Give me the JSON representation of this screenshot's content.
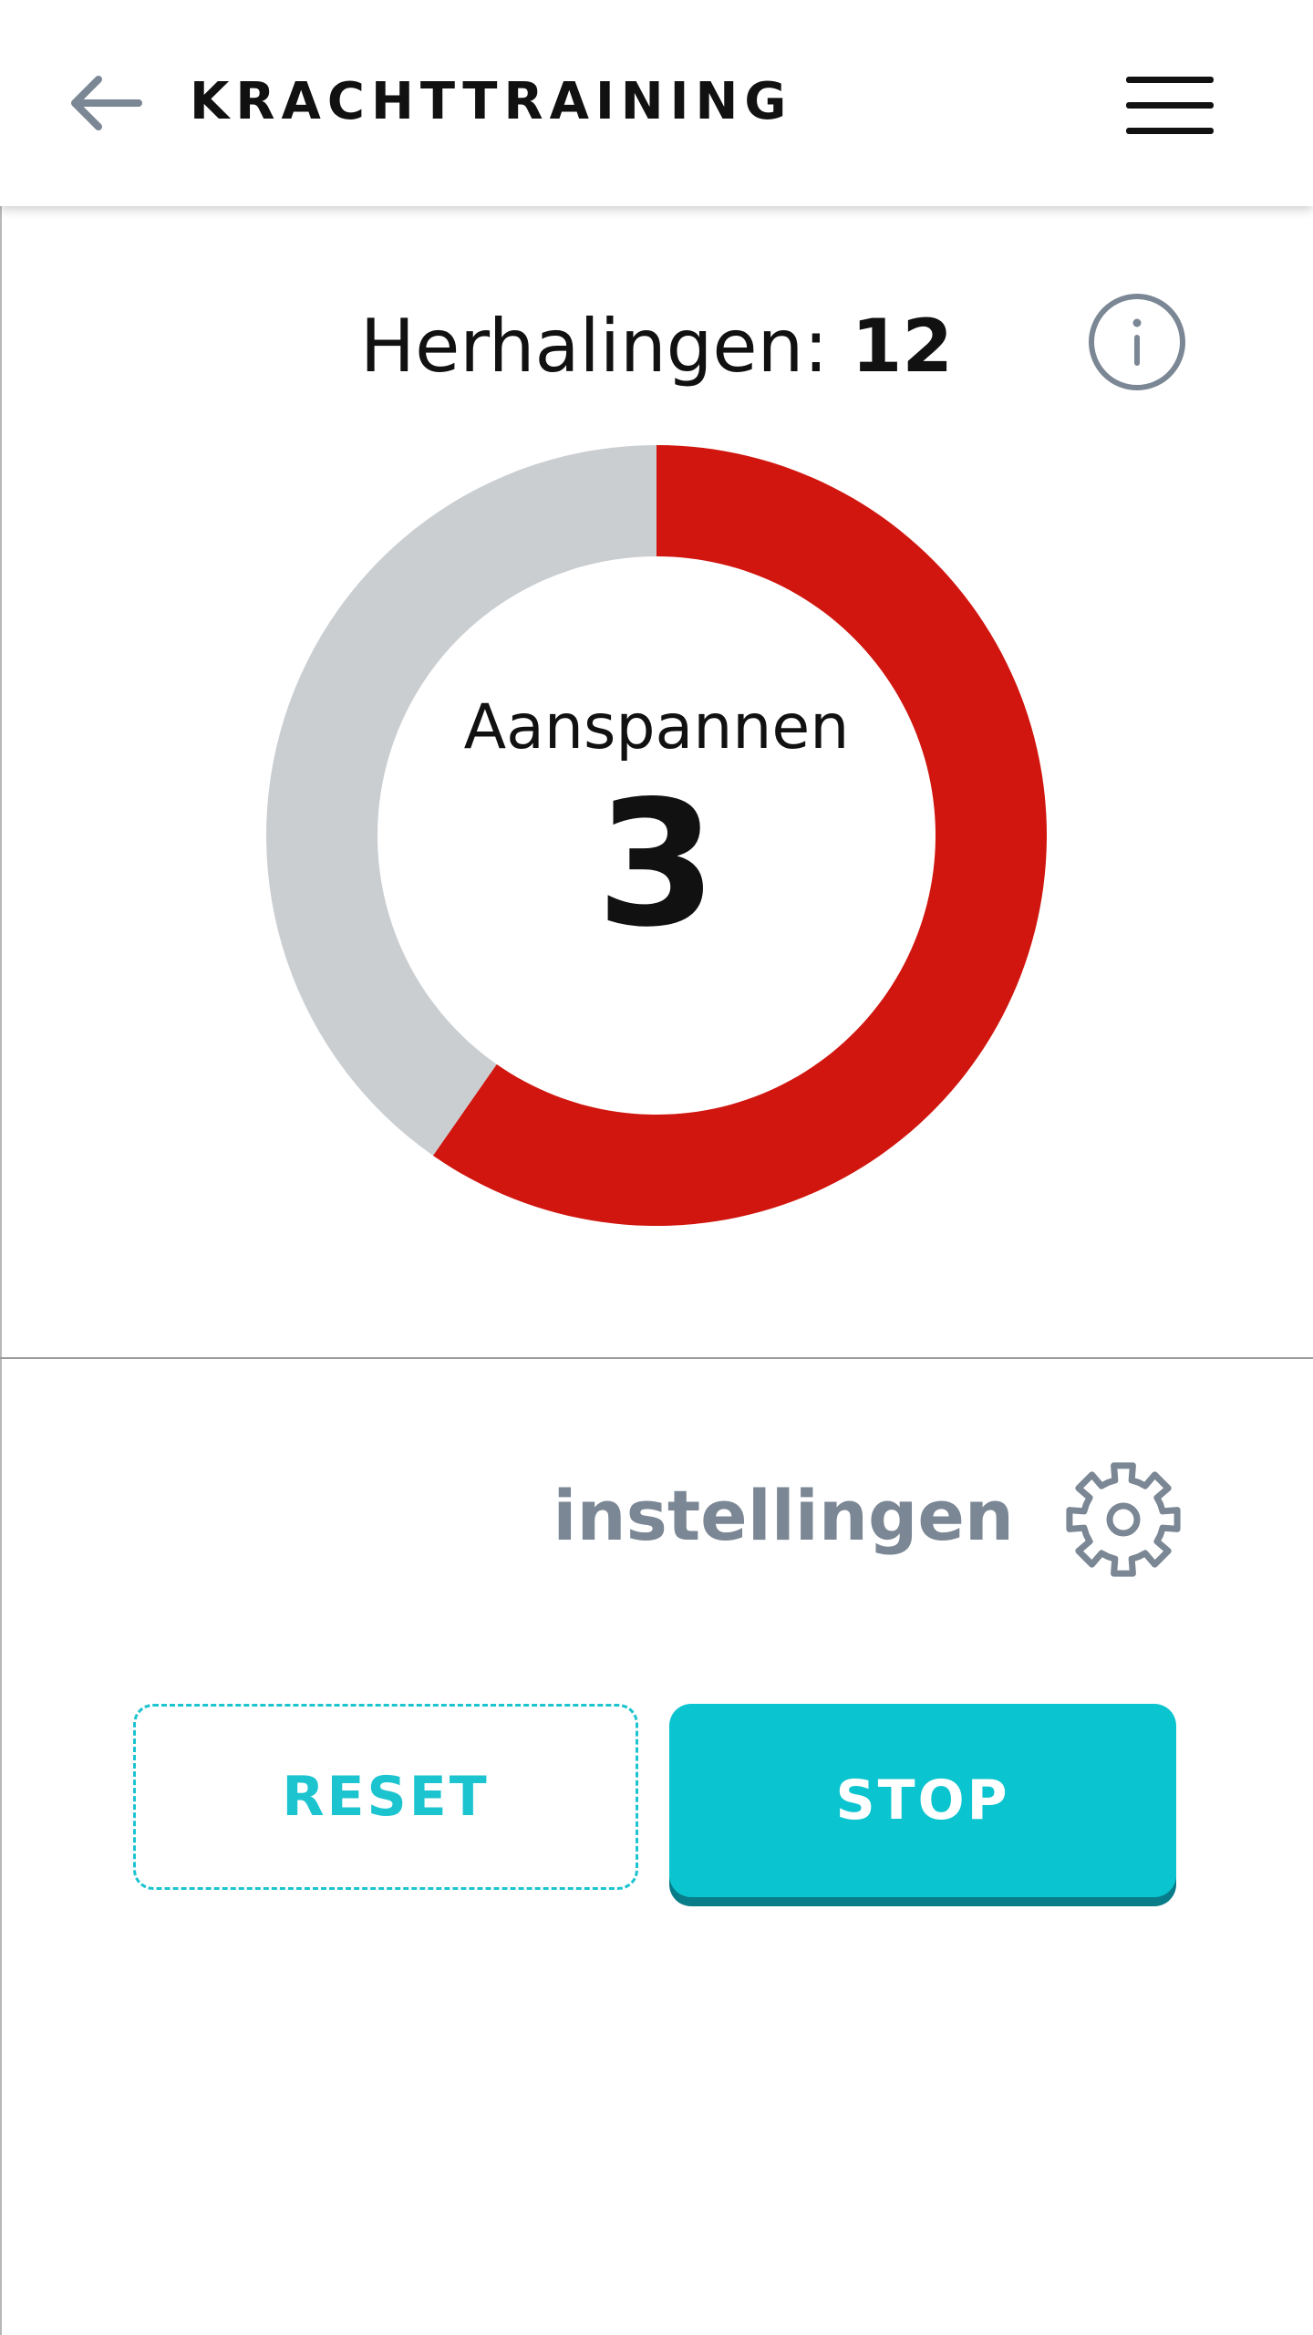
{
  "header": {
    "title": "KRACHTTRAINING",
    "back_icon": "arrow-left-icon",
    "menu_icon": "hamburger-menu-icon"
  },
  "exercise": {
    "reps_label": "Herhalingen:",
    "reps_value": "12",
    "info_icon": "info-icon",
    "phase_label": "Aanspannen",
    "count": "3",
    "progress_fraction": 0.597
  },
  "settings": {
    "label": "instellingen",
    "icon": "gear-icon"
  },
  "actions": {
    "reset_label": "RESET",
    "stop_label": "STOP"
  },
  "colors": {
    "progress": "#d0160f",
    "track": "#cbced1",
    "accent": "#0ac4cf",
    "accent_dark": "#087c88",
    "muted": "#7b8794"
  }
}
